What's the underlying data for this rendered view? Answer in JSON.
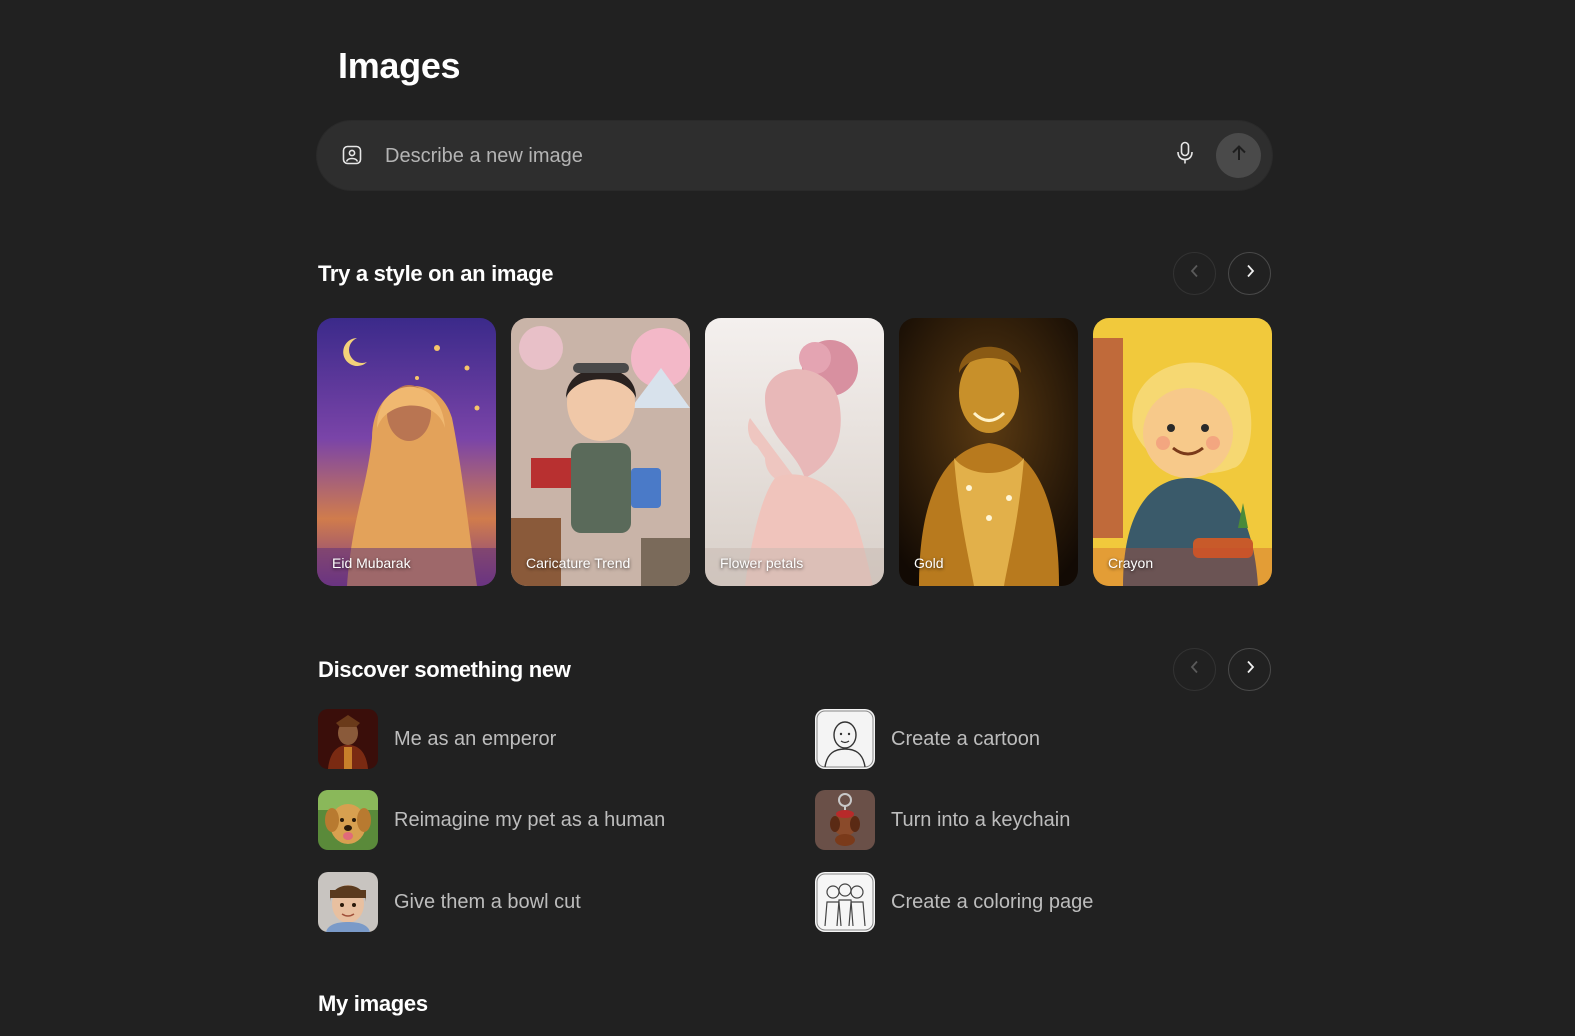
{
  "header": {
    "title": "Images"
  },
  "prompt": {
    "placeholder": "Describe a new image",
    "value": ""
  },
  "styles_section": {
    "title": "Try a style on an image",
    "cards": [
      {
        "label": "Eid Mubarak"
      },
      {
        "label": "Caricature Trend"
      },
      {
        "label": "Flower petals"
      },
      {
        "label": "Gold"
      },
      {
        "label": "Crayon"
      }
    ]
  },
  "discover_section": {
    "title": "Discover something new",
    "items": [
      {
        "label": "Me as an emperor"
      },
      {
        "label": "Create a cartoon"
      },
      {
        "label": "Reimagine my pet as a human"
      },
      {
        "label": "Turn into a keychain"
      },
      {
        "label": "Give them a bowl cut"
      },
      {
        "label": "Create a coloring page"
      }
    ]
  },
  "my_images_section": {
    "title": "My images"
  },
  "colors": {
    "background": "#212121",
    "prompt_bar": "#2e2e2e",
    "send_button": "#4a4a4a",
    "label_text": "#bdbdbd"
  }
}
